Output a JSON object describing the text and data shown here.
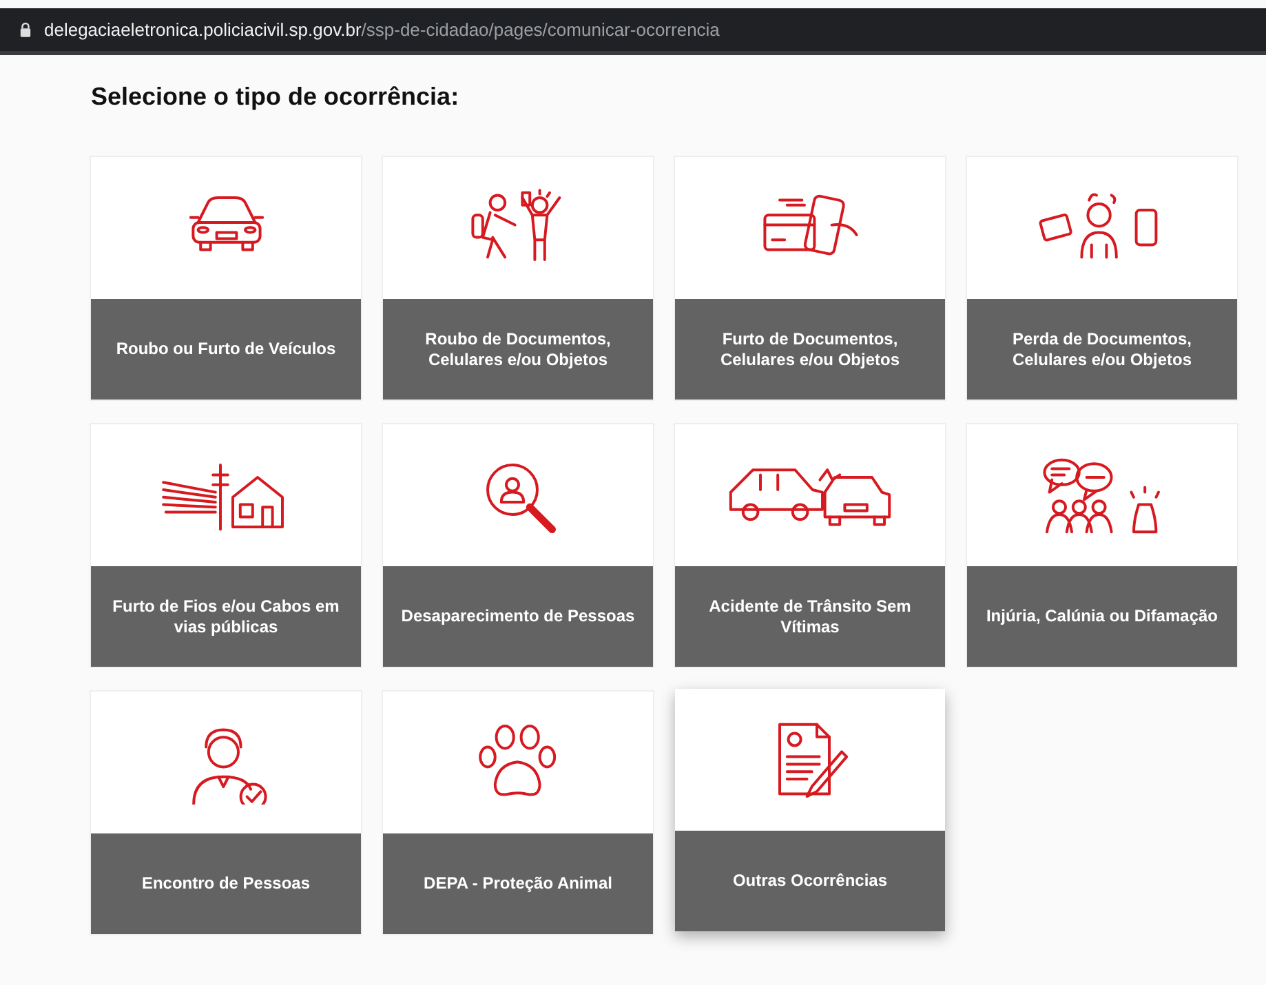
{
  "address_bar": {
    "domain": "delegaciaeletronica.policiacivil.sp.gov.br",
    "path": "/ssp-de-cidadao/pages/comunicar-ocorrencia"
  },
  "heading": "Selecione o tipo de ocorrência:",
  "options": [
    {
      "label": "Roubo ou Furto de Veículos",
      "hovered": false
    },
    {
      "label": "Roubo de Documentos, Celulares e/ou Objetos",
      "hovered": false
    },
    {
      "label": "Furto de Documentos, Celulares e/ou Objetos",
      "hovered": false
    },
    {
      "label": "Perda de Documentos, Celulares e/ou Objetos",
      "hovered": false
    },
    {
      "label": "Furto de Fios e/ou Cabos em vias públicas",
      "hovered": false
    },
    {
      "label": "Desaparecimento de Pessoas",
      "hovered": false
    },
    {
      "label": "Acidente de Trânsito Sem Vítimas",
      "hovered": false
    },
    {
      "label": "Injúria, Calúnia ou Difamação",
      "hovered": false
    },
    {
      "label": "Encontro de Pessoas",
      "hovered": false
    },
    {
      "label": "DEPA - Proteção Animal",
      "hovered": false
    },
    {
      "label": "Outras Ocorrências",
      "hovered": true
    }
  ]
}
